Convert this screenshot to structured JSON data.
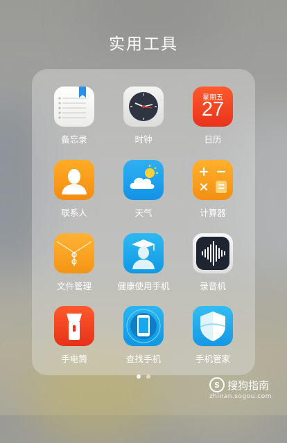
{
  "folder": {
    "title": "实用工具",
    "apps": [
      {
        "label": "备忘录",
        "icon": "memo-icon"
      },
      {
        "label": "时钟",
        "icon": "clock-icon"
      },
      {
        "label": "日历",
        "icon": "calendar-icon",
        "weekday": "星期五",
        "day": "27"
      },
      {
        "label": "联系人",
        "icon": "contacts-icon"
      },
      {
        "label": "天气",
        "icon": "weather-icon"
      },
      {
        "label": "计算器",
        "icon": "calculator-icon"
      },
      {
        "label": "文件管理",
        "icon": "file-manager-icon"
      },
      {
        "label": "健康使用手机",
        "icon": "health-icon"
      },
      {
        "label": "录音机",
        "icon": "recorder-icon"
      },
      {
        "label": "手电筒",
        "icon": "flashlight-icon"
      },
      {
        "label": "查找手机",
        "icon": "find-phone-icon"
      },
      {
        "label": "手机管家",
        "icon": "phone-manager-icon"
      }
    ],
    "pages": 2,
    "current_page": 1
  },
  "watermark": {
    "text": "搜狗指南",
    "url": "zhinan.sogou.com"
  },
  "colors": {
    "calendar": "#e8331b",
    "orange": "#f48c10",
    "blue": "#1293e6"
  }
}
